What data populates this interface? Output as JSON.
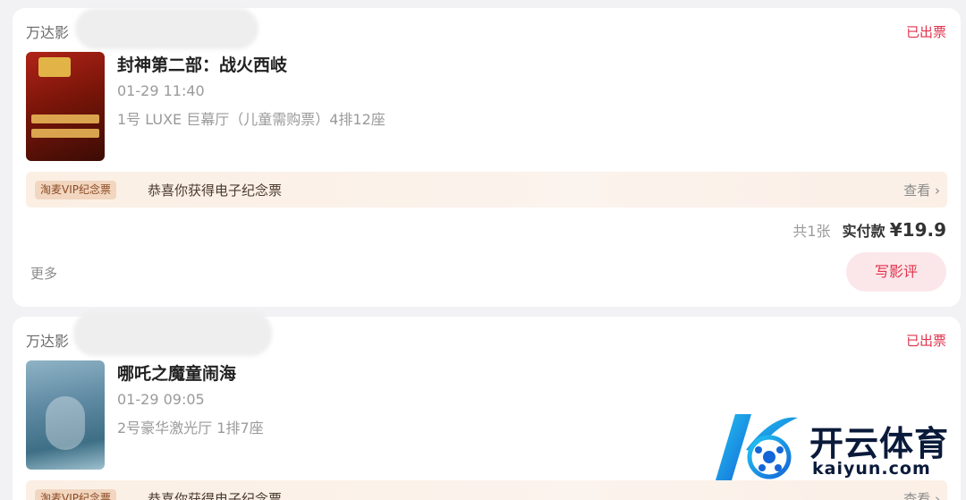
{
  "orders": [
    {
      "cinema": "万达影",
      "status": "已出票",
      "movie_title": "封神第二部：战火西岐",
      "showtime": "01-29 11:40",
      "hall_seat": "1号 LUXE 巨幕厅（儿童需购票）4排12座",
      "vip_tag": "淘麦VIP纪念票",
      "vip_message": "恭喜你获得电子纪念票",
      "vip_view": "查看 ›",
      "ticket_count": "共1张",
      "paid_label": "实付款",
      "paid_amount": "¥19.9",
      "more": "更多",
      "review_button": "写影评"
    },
    {
      "cinema": "万达影",
      "status": "已出票",
      "movie_title": "哪吒之魔童闹海",
      "showtime": "01-29 09:05",
      "hall_seat": "2号豪华激光厅 1排7座",
      "vip_tag": "淘麦VIP纪念票",
      "vip_message": "恭喜你获得电子纪念票",
      "vip_view": "查看 ›"
    }
  ],
  "watermark": {
    "logo_icon": "k-ball-logo-icon",
    "name": "开云体育",
    "url": "kaiyun.com"
  },
  "colors": {
    "accent_red": "#e0324b",
    "review_bg": "#fbe7ea",
    "vip_bg": "#fbefe4",
    "logo_blue": "#1aa3e8"
  }
}
